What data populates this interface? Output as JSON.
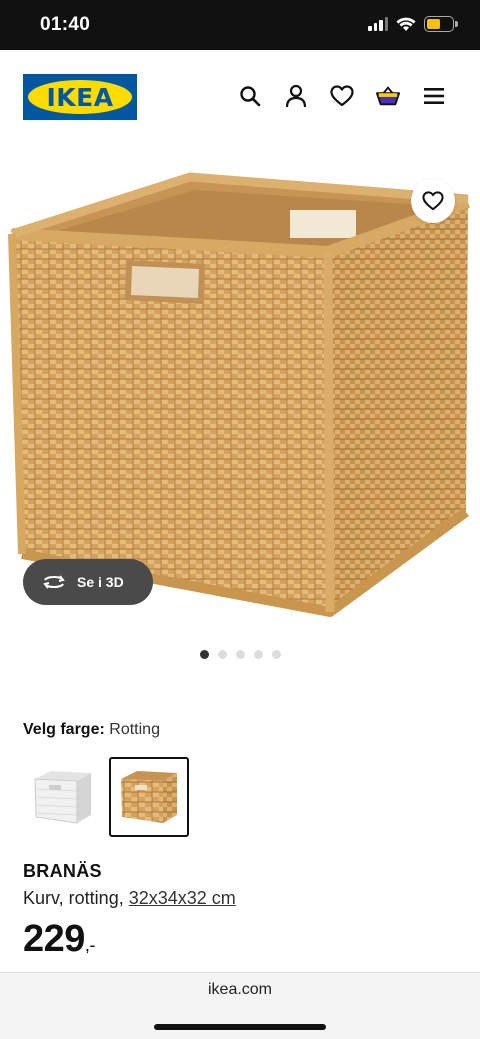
{
  "status_bar": {
    "time": "01:40"
  },
  "header": {
    "logo_text": "IKEA",
    "icons": [
      "search-icon",
      "profile-icon",
      "heart-icon",
      "cart-icon",
      "menu-icon"
    ]
  },
  "gallery": {
    "view3d_label": "Se i 3D",
    "dot_count": 5,
    "active_dot": 1
  },
  "color_select": {
    "label": "Velg farge:",
    "value": "Rotting",
    "options": [
      "white",
      "rattan"
    ],
    "selected": "rattan"
  },
  "product": {
    "name": "BRANÄS",
    "desc": "Kurv, rotting,",
    "size": "32x34x32 cm",
    "price": "229",
    "price_suffix": ",-"
  },
  "browser": {
    "url": "ikea.com"
  },
  "colors": {
    "ikea_blue": "#0058a3",
    "ikea_yellow": "#ffdb00",
    "rattan": "#d9a766"
  }
}
